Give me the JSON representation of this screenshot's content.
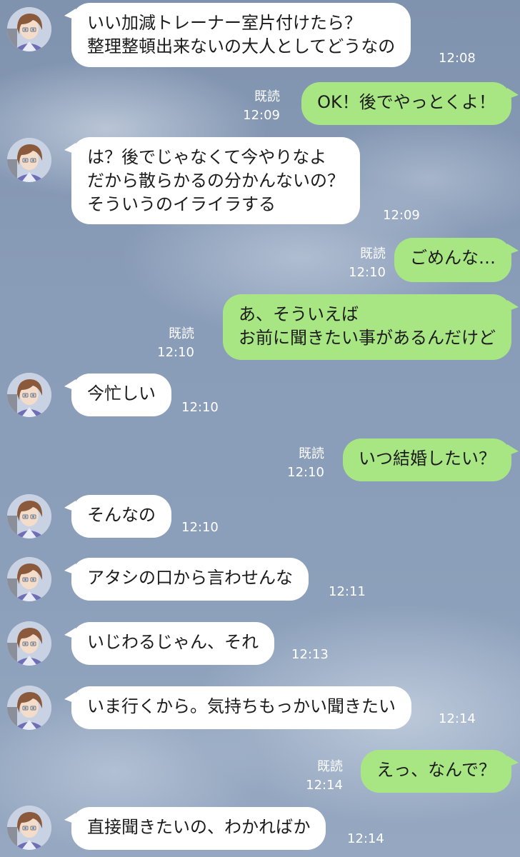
{
  "theme": {
    "incoming_bubble": "#ffffff",
    "outgoing_bubble": "#a8e683",
    "meta_text": "#ffffff"
  },
  "messages": [
    {
      "side": "in",
      "text": "いい加減トレーナー室片付けたら？\n整理整頓出来ないの大人としてどうなの",
      "time": "12:08"
    },
    {
      "side": "out",
      "text": "OK！後でやっとくよ！",
      "read": "既読",
      "time": "12:09"
    },
    {
      "side": "in",
      "text": "は？後でじゃなくて今やりなよ\nだから散らかるの分かんないの？\nそういうのイライラする",
      "time": "12:09"
    },
    {
      "side": "out",
      "text": "ごめんな…",
      "read": "既読",
      "time": "12:10"
    },
    {
      "side": "out",
      "text": "あ、そういえば\nお前に聞きたい事があるんだけど",
      "read": "既読",
      "time": "12:10"
    },
    {
      "side": "in",
      "text": "今忙しい",
      "time": "12:10"
    },
    {
      "side": "out",
      "text": "いつ結婚したい？",
      "read": "既読",
      "time": "12:10"
    },
    {
      "side": "in",
      "text": "そんなの",
      "time": "12:10"
    },
    {
      "side": "in",
      "text": "アタシの口から言わせんな",
      "time": "12:11"
    },
    {
      "side": "in",
      "text": "いじわるじゃん、それ",
      "time": "12:13"
    },
    {
      "side": "in",
      "text": "いま行くから。気持ちもっかい聞きたい",
      "time": "12:14"
    },
    {
      "side": "out",
      "text": "えっ、なんで？",
      "read": "既読",
      "time": "12:14"
    },
    {
      "side": "in",
      "text": "直接聞きたいの、わかればか",
      "time": "12:14"
    }
  ]
}
